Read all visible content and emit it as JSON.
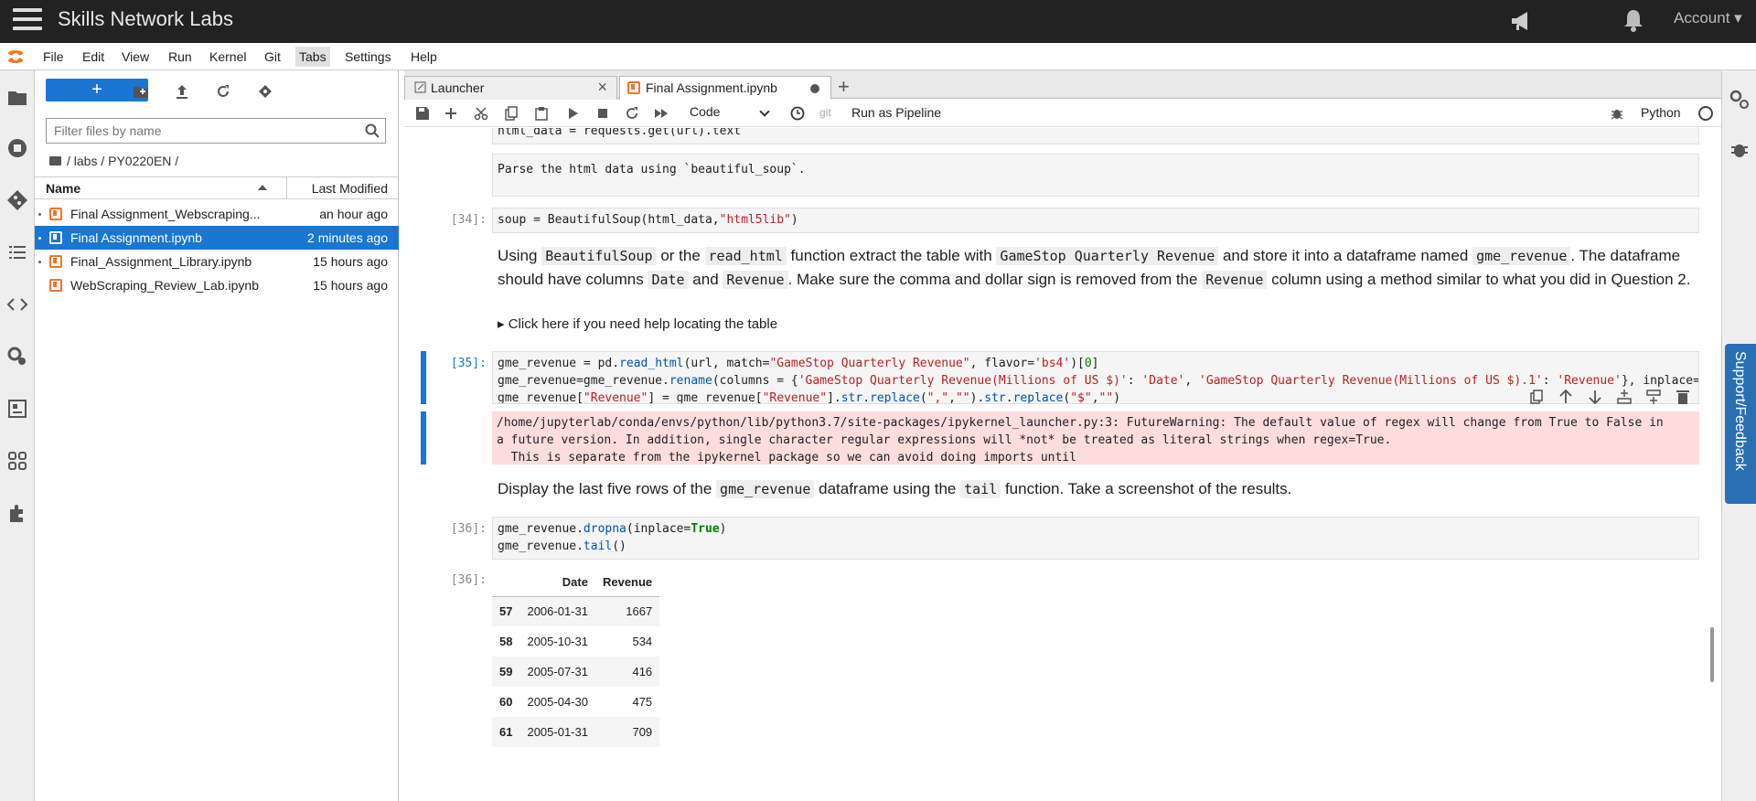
{
  "topbar": {
    "brand": "Skills Network Labs",
    "account": "Account ▾"
  },
  "menu": [
    "File",
    "Edit",
    "View",
    "Run",
    "Kernel",
    "Git",
    "Tabs",
    "Settings",
    "Help"
  ],
  "filebrowser": {
    "new_label": "+",
    "filter_placeholder": "Filter files by name",
    "breadcrumb": "/ labs / PY0220EN /",
    "header_name": "Name",
    "header_modified": "Last Modified",
    "files": [
      {
        "name": "Final Assignment_Webscraping...",
        "modified": "an hour ago",
        "selected": false
      },
      {
        "name": "Final Assignment.ipynb",
        "modified": "2 minutes ago",
        "selected": true
      },
      {
        "name": "Final_Assignment_Library.ipynb",
        "modified": "15 hours ago",
        "selected": false
      },
      {
        "name": "WebScraping_Review_Lab.ipynb",
        "modified": "15 hours ago",
        "selected": false
      }
    ]
  },
  "tabs": {
    "launcher": "Launcher",
    "notebook": "Final Assignment.ipynb"
  },
  "toolbar": {
    "cell_type": "Code",
    "git": "git",
    "run_pipeline": "Run as Pipeline",
    "kernel": "Python"
  },
  "notebook": {
    "line_top": "html_data = requests.get(url).text",
    "md_parse": "Parse the html data using `beautiful_soup`.",
    "prompt_34": "[34]:",
    "prompt_35": "[35]:",
    "prompt_36": "[36]:",
    "prompt_36_out": "[36]:",
    "md_q_part1": "Using ",
    "md_q_code1": "BeautifulSoup",
    "md_q_part2": " or the ",
    "md_q_code2": "read_html",
    "md_q_part3": " function extract the table with ",
    "md_q_code3": "GameStop Quarterly Revenue",
    "md_q_part4": " and store it into a dataframe named ",
    "md_q_code4": "gme_revenue",
    "md_q_part5": ". The dataframe should have columns ",
    "md_q_code5": "Date",
    "md_q_part6": " and ",
    "md_q_code6": "Revenue",
    "md_q_part7": ". Make sure the comma and dollar sign is removed from the ",
    "md_q_code7": "Revenue",
    "md_q_part8": " column using a method similar to what you did in Question 2.",
    "md_help": "▸ Click here if you need help locating the table",
    "stderr": "/home/jupyterlab/conda/envs/python/lib/python3.7/site-packages/ipykernel_launcher.py:3: FutureWarning: The default value of regex will change from True to False in\na future version. In addition, single character regular expressions will *not* be treated as literal strings when regex=True.\n  This is separate from the ipykernel package so we can avoid doing imports until",
    "md_tail_part1": "Display the last five rows of the ",
    "md_tail_code1": "gme_revenue",
    "md_tail_part2": " dataframe using the ",
    "md_tail_code2": "tail",
    "md_tail_part3": " function. Take a screenshot of the results.",
    "table": {
      "columns": [
        "",
        "Date",
        "Revenue"
      ],
      "rows": [
        [
          "57",
          "2006-01-31",
          "1667"
        ],
        [
          "58",
          "2005-10-31",
          "534"
        ],
        [
          "59",
          "2005-07-31",
          "416"
        ],
        [
          "60",
          "2005-04-30",
          "475"
        ],
        [
          "61",
          "2005-01-31",
          "709"
        ]
      ]
    }
  },
  "support": "Support/Feedback"
}
